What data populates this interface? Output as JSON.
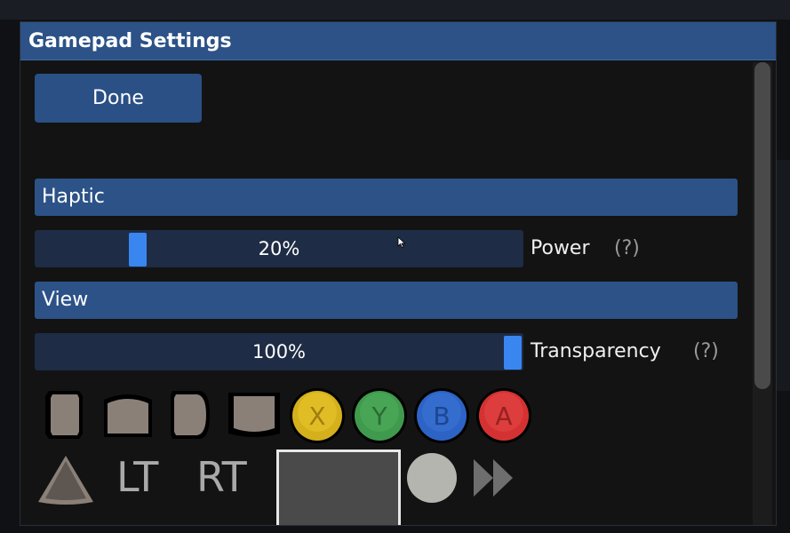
{
  "dialog": {
    "title": "Gamepad Settings",
    "done_label": "Done"
  },
  "haptic": {
    "header": "Haptic",
    "slider_value": "20%",
    "level": 0.2,
    "label": "Power",
    "help": "(?)"
  },
  "view": {
    "header": "View",
    "slider_value": "100%",
    "level": 1.0,
    "label": "Transparency",
    "help": "(?)"
  },
  "gamepad": {
    "buttons": [
      {
        "name": "X",
        "color": "#d4b01c"
      },
      {
        "name": "Y",
        "color": "#3f9a4d"
      },
      {
        "name": "B",
        "color": "#2d63c4"
      },
      {
        "name": "A",
        "color": "#d43232"
      }
    ],
    "lt_label": "LT",
    "rt_label": "RT",
    "icons": [
      "left-bumper-icon",
      "top-left-bumper-icon",
      "right-bumper-icon",
      "top-right-bumper-icon",
      "triangle-icon",
      "circle-button-icon",
      "fast-forward-icon"
    ]
  },
  "colors": {
    "accent": "#2c5287",
    "slider_fill": "#1e2c45",
    "knob": "#3a86f0"
  }
}
